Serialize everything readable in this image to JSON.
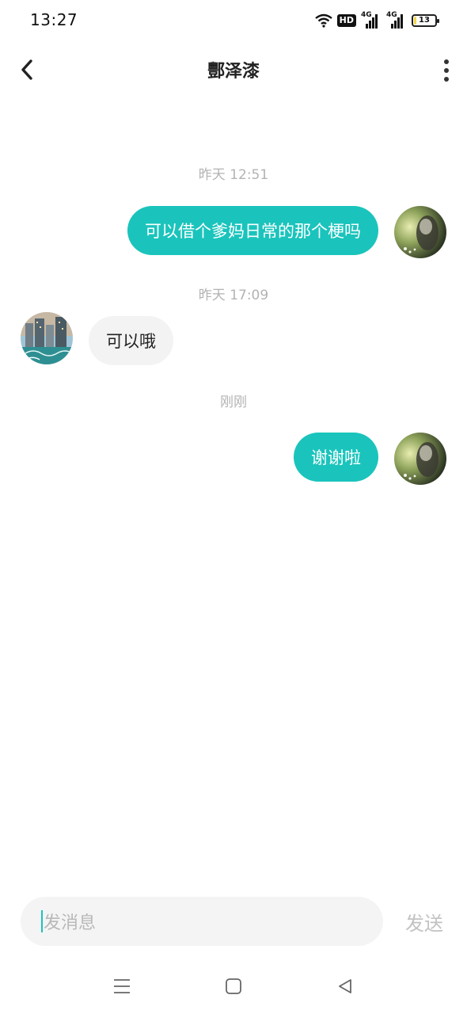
{
  "status_bar": {
    "time": "13:27",
    "hd_label": "HD",
    "signal_label_1": "4G",
    "signal_label_2": "4G",
    "battery_level": "13",
    "icons": [
      "wifi-icon",
      "hd-icon",
      "signal-4g-icon",
      "signal-4g-icon",
      "battery-icon"
    ]
  },
  "header": {
    "title": "酆泽漆",
    "back_icon": "chevron-left-icon",
    "more_icon": "more-vertical-icon"
  },
  "messages": [
    {
      "type": "timestamp",
      "text": "昨天 12:51"
    },
    {
      "type": "message",
      "direction": "outgoing",
      "text": "可以借个爹妈日常的那个梗吗"
    },
    {
      "type": "timestamp",
      "text": "昨天 17:09"
    },
    {
      "type": "message",
      "direction": "incoming",
      "text": "可以哦"
    },
    {
      "type": "timestamp",
      "text": "刚刚"
    },
    {
      "type": "message",
      "direction": "outgoing",
      "text": "谢谢啦"
    }
  ],
  "input": {
    "placeholder": "发消息",
    "send_label": "发送"
  },
  "nav_bar": {
    "icons": [
      "menu-icon",
      "home-square-icon",
      "back-triangle-icon"
    ]
  },
  "colors": {
    "accent": "#1ac4bc",
    "incoming_bubble": "#f3f3f3",
    "timestamp_text": "#b3b3b3"
  }
}
